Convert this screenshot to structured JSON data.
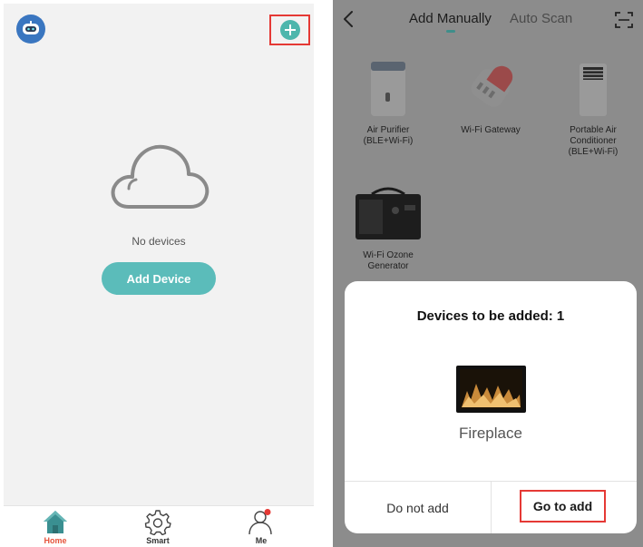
{
  "home": {
    "empty_text": "No devices",
    "add_device_label": "Add Device",
    "tabs": [
      {
        "label": "Home",
        "icon": "home-icon"
      },
      {
        "label": "Smart",
        "icon": "gear-icon"
      },
      {
        "label": "Me",
        "icon": "person-icon"
      }
    ]
  },
  "add_screen": {
    "tabs": [
      {
        "label": "Add Manually",
        "active": true
      },
      {
        "label": "Auto Scan",
        "active": false
      }
    ],
    "devices": [
      {
        "label": "Air Purifier\n(BLE+Wi-Fi)"
      },
      {
        "label": "Wi-Fi Gateway"
      },
      {
        "label": "Portable Air\nConditioner\n(BLE+Wi-Fi)"
      },
      {
        "label": "Wi-Fi Ozone\nGenerator"
      }
    ],
    "dialog": {
      "title": "Devices to be added: 1",
      "device_name": "Fireplace",
      "cancel_label": "Do not add",
      "confirm_label": "Go to add"
    }
  },
  "colors": {
    "accent": "#5bbcba",
    "highlight": "#e53935",
    "active_tab": "#e5533b"
  }
}
